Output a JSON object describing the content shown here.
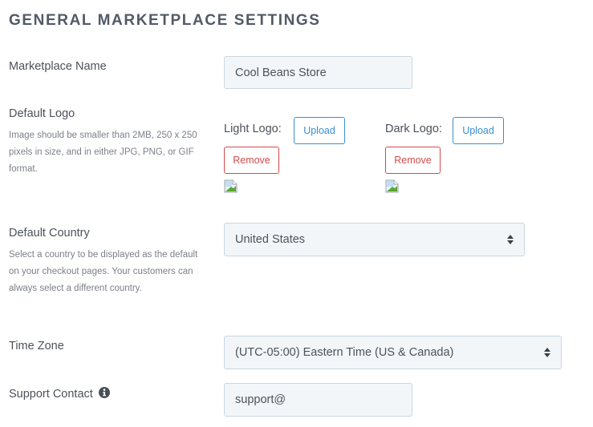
{
  "page": {
    "title": "GENERAL MARKETPLACE SETTINGS"
  },
  "marketplace_name": {
    "label": "Marketplace Name",
    "value": "Cool Beans Store"
  },
  "default_logo": {
    "label": "Default Logo",
    "help": "Image should be smaller than 2MB, 250 x 250 pixels in size, and in either JPG, PNG, or GIF format.",
    "light": {
      "label": "Light Logo:",
      "upload_label": "Upload",
      "remove_label": "Remove",
      "image_icon": "broken-image-icon"
    },
    "dark": {
      "label": "Dark Logo:",
      "upload_label": "Upload",
      "remove_label": "Remove",
      "image_icon": "broken-image-icon"
    }
  },
  "default_country": {
    "label": "Default Country",
    "help": "Select a country to be displayed as the default on your checkout pages. Your customers can always select a different country.",
    "selected": "United States"
  },
  "time_zone": {
    "label": "Time Zone",
    "selected": "(UTC-05:00) Eastern Time (US & Canada)"
  },
  "support_contact": {
    "label": "Support Contact",
    "icon": "info-circle-icon",
    "value": "support@"
  },
  "colors": {
    "upload_accent": "#3a8fd0",
    "remove_accent": "#d64a4a",
    "field_bg": "#f3f6f9",
    "field_border": "#c9d6e0"
  }
}
